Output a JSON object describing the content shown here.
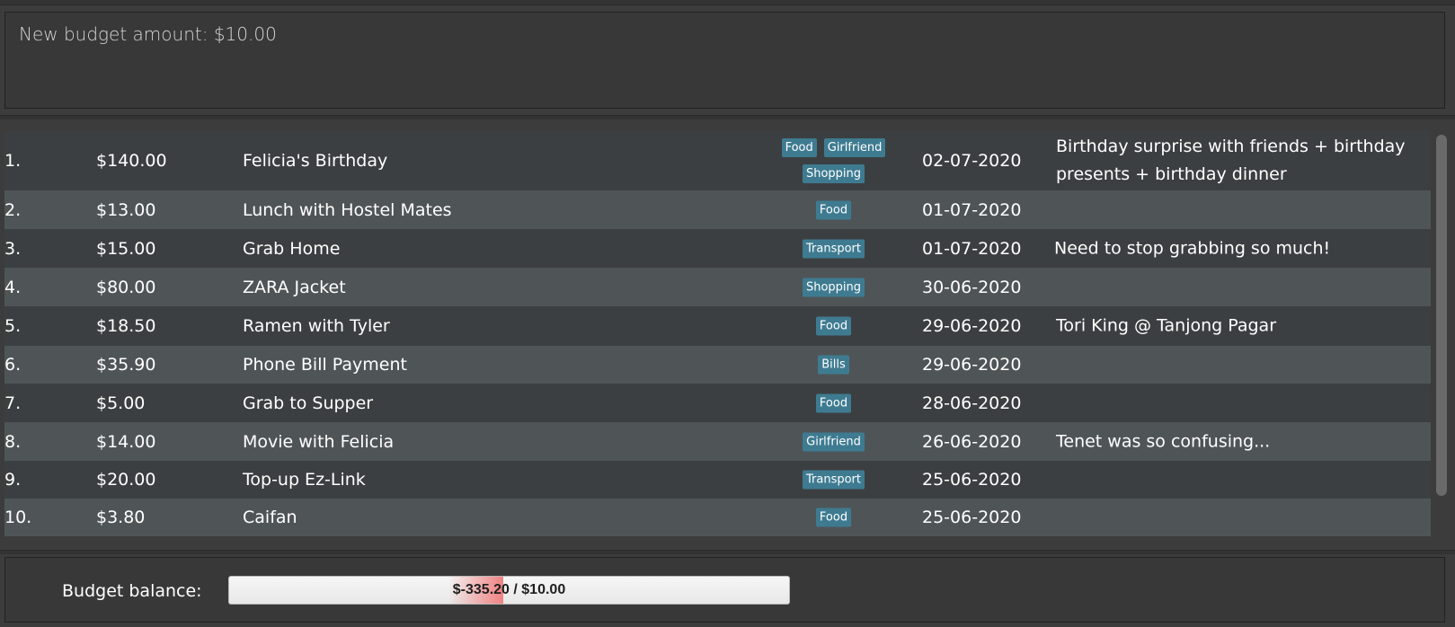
{
  "result_display": "New budget amount: $10.00",
  "expenses": [
    {
      "index": "1.",
      "amount": "$140.00",
      "description": "Felicia's Birthday",
      "tags": [
        "Food",
        "Girlfriend",
        "Shopping"
      ],
      "date": "02-07-2020",
      "remark": "Birthday surprise with friends + birthday presents + birthday dinner"
    },
    {
      "index": "2.",
      "amount": "$13.00",
      "description": "Lunch with Hostel Mates",
      "tags": [
        "Food"
      ],
      "date": "01-07-2020",
      "remark": ""
    },
    {
      "index": "3.",
      "amount": "$15.00",
      "description": "Grab Home",
      "tags": [
        "Transport"
      ],
      "date": "01-07-2020",
      "remark": "Need to stop grabbing so much!"
    },
    {
      "index": "4.",
      "amount": "$80.00",
      "description": "ZARA Jacket",
      "tags": [
        "Shopping"
      ],
      "date": "30-06-2020",
      "remark": ""
    },
    {
      "index": "5.",
      "amount": "$18.50",
      "description": "Ramen with Tyler",
      "tags": [
        "Food"
      ],
      "date": "29-06-2020",
      "remark": "Tori King @ Tanjong Pagar"
    },
    {
      "index": "6.",
      "amount": "$35.90",
      "description": "Phone Bill Payment",
      "tags": [
        "Bills"
      ],
      "date": "29-06-2020",
      "remark": ""
    },
    {
      "index": "7.",
      "amount": "$5.00",
      "description": "Grab to Supper",
      "tags": [
        "Food"
      ],
      "date": "28-06-2020",
      "remark": ""
    },
    {
      "index": "8.",
      "amount": "$14.00",
      "description": "Movie with Felicia",
      "tags": [
        "Girlfriend"
      ],
      "date": "26-06-2020",
      "remark": "Tenet was so confusing..."
    },
    {
      "index": "9.",
      "amount": "$20.00",
      "description": "Top-up Ez-Link",
      "tags": [
        "Transport"
      ],
      "date": "25-06-2020",
      "remark": ""
    },
    {
      "index": "10.",
      "amount": "$3.80",
      "description": "Caifan",
      "tags": [
        "Food"
      ],
      "date": "25-06-2020",
      "remark": ""
    }
  ],
  "budget": {
    "label": "Budget balance:",
    "display": "$-335.20 / $10.00",
    "fill_fraction": 0.49
  },
  "colors": {
    "tag_background": "#3e7b91",
    "row_odd": "#3c3f41",
    "row_even": "#4f5557",
    "bar_fill": "#f08282"
  }
}
